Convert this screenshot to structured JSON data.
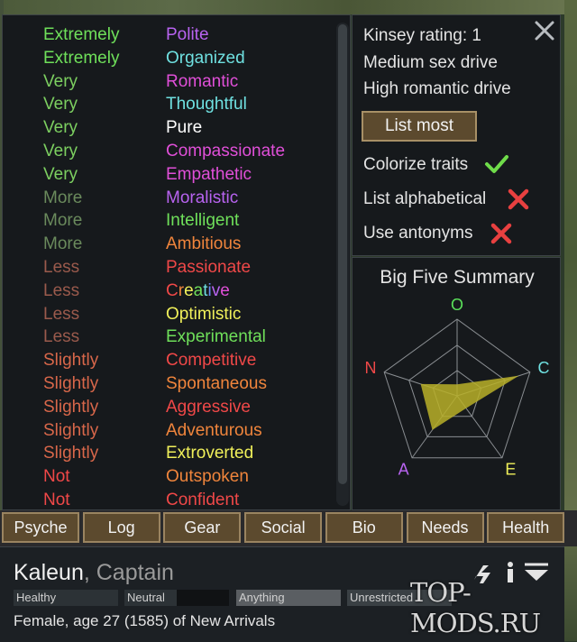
{
  "traits": [
    {
      "degree": "Extremely",
      "degree_color": "#6fe05a",
      "name": "Polite",
      "name_color": "#b863f0"
    },
    {
      "degree": "Extremely",
      "degree_color": "#6fe05a",
      "name": "Organized",
      "name_color": "#6fe0e0"
    },
    {
      "degree": "Very",
      "degree_color": "#7ccf60",
      "name": "Romantic",
      "name_color": "#e04fd8"
    },
    {
      "degree": "Very",
      "degree_color": "#7ccf60",
      "name": "Thoughtful",
      "name_color": "#6fe0e0"
    },
    {
      "degree": "Very",
      "degree_color": "#7ccf60",
      "name": "Pure",
      "name_color": "#ffffff"
    },
    {
      "degree": "Very",
      "degree_color": "#7ccf60",
      "name": "Compassionate",
      "name_color": "#e04fd8"
    },
    {
      "degree": "Very",
      "degree_color": "#7ccf60",
      "name": "Empathetic",
      "name_color": "#e04fd8"
    },
    {
      "degree": "More",
      "degree_color": "#6a8a5c",
      "name": "Moralistic",
      "name_color": "#b863f0"
    },
    {
      "degree": "More",
      "degree_color": "#6a8a5c",
      "name": "Intelligent",
      "name_color": "#6fe05a"
    },
    {
      "degree": "More",
      "degree_color": "#6a8a5c",
      "name": "Ambitious",
      "name_color": "#f0853c"
    },
    {
      "degree": "Less",
      "degree_color": "#9a5a4c",
      "name": "Passionate",
      "name_color": "#f04848"
    },
    {
      "degree": "Less",
      "degree_color": "#9a5a4c",
      "name": "Creative",
      "name_color": "rainbow"
    },
    {
      "degree": "Less",
      "degree_color": "#9a5a4c",
      "name": "Optimistic",
      "name_color": "#f0f05a"
    },
    {
      "degree": "Less",
      "degree_color": "#9a5a4c",
      "name": "Experimental",
      "name_color": "#6fe05a"
    },
    {
      "degree": "Slightly",
      "degree_color": "#d8674a",
      "name": "Competitive",
      "name_color": "#f04848"
    },
    {
      "degree": "Slightly",
      "degree_color": "#d8674a",
      "name": "Spontaneous",
      "name_color": "#f0853c"
    },
    {
      "degree": "Slightly",
      "degree_color": "#d8674a",
      "name": "Aggressive",
      "name_color": "#f04848"
    },
    {
      "degree": "Slightly",
      "degree_color": "#d8674a",
      "name": "Adventurous",
      "name_color": "#f0853c"
    },
    {
      "degree": "Slightly",
      "degree_color": "#d8674a",
      "name": "Extroverted",
      "name_color": "#f0f05a"
    },
    {
      "degree": "Not",
      "degree_color": "#f04848",
      "name": "Outspoken",
      "name_color": "#f0853c"
    },
    {
      "degree": "Not",
      "degree_color": "#f04848",
      "name": "Confident",
      "name_color": "#f04848"
    }
  ],
  "settings": {
    "kinsey": "Kinsey rating: 1",
    "sex_drive": "Medium sex drive",
    "romantic_drive": "High romantic drive",
    "list_button": "List most",
    "colorize": {
      "label": "Colorize traits",
      "state": "check-icon"
    },
    "alphabetical": {
      "label": "List alphabetical",
      "state": "cross-icon"
    },
    "antonyms": {
      "label": "Use antonyms",
      "state": "cross-icon"
    }
  },
  "bigfive": {
    "title": "Big Five Summary",
    "labels": {
      "O": "O",
      "C": "C",
      "E": "E",
      "A": "A",
      "N": "N"
    },
    "label_colors": {
      "O": "#5ae05a",
      "C": "#6fe0e0",
      "E": "#f0f05a",
      "A": "#b863f0",
      "N": "#f04848"
    },
    "values": {
      "O": 0.15,
      "C": 0.85,
      "E": 0.2,
      "A": 0.55,
      "N": 0.5
    },
    "fill_color": "#b8b028"
  },
  "tabs": [
    "Psyche",
    "Log",
    "Gear",
    "Social",
    "Bio",
    "Needs",
    "Health"
  ],
  "pawn": {
    "name": "Kaleun",
    "title": ", Captain",
    "bars": {
      "health": "Healthy",
      "mood": "Neutral",
      "food": "Anything",
      "area": "Unrestricted"
    },
    "description": "Female, age 27 (1585) of New Arrivals"
  },
  "watermark": "TOP-MODS.RU"
}
